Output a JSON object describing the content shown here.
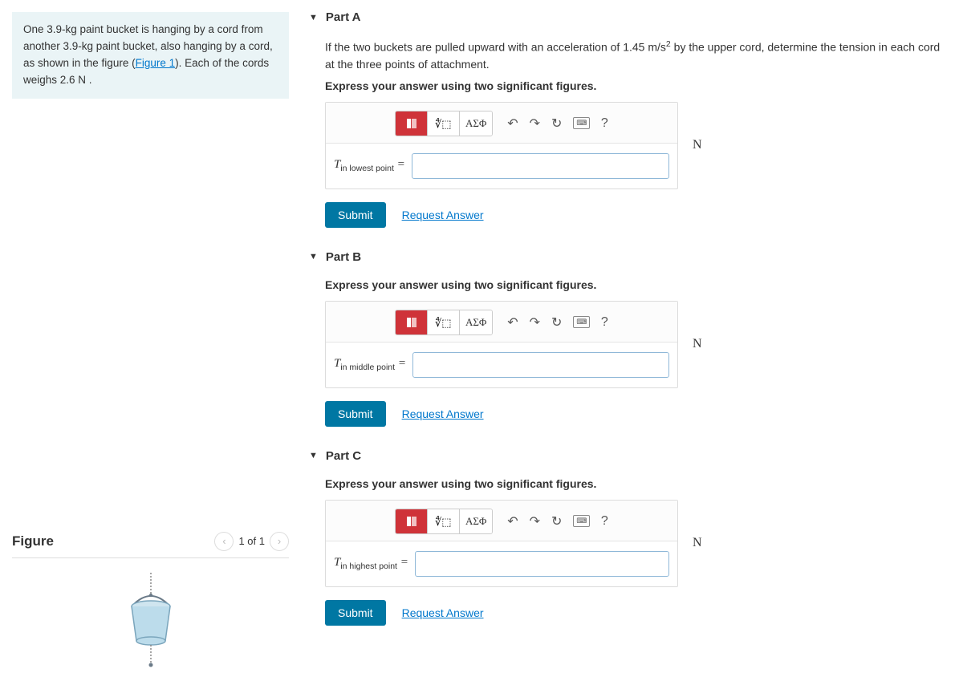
{
  "problem": {
    "text_before_link": "One 3.9-kg paint bucket is hanging by a cord from another 3.9-kg paint bucket, also hanging by a cord, as shown in the figure (",
    "link_text": "Figure 1",
    "text_after_link": "). Each of the cords weighs 2.6 N ."
  },
  "figure": {
    "title": "Figure",
    "counter": "1 of 1"
  },
  "parts": {
    "a": {
      "header": "Part A",
      "prompt_prefix": "If the two buckets are pulled upward with an acceleration of 1.45 ",
      "prompt_unit": "m/s",
      "prompt_suffix": " by the upper cord, determine the tension in each cord at the three points of attachment.",
      "sigfigs": "Express your answer using two significant figures.",
      "var_main": "T",
      "var_sub": "in lowest point",
      "equals": " = ",
      "unit": "N",
      "submit": "Submit",
      "request": "Request Answer"
    },
    "b": {
      "header": "Part B",
      "sigfigs": "Express your answer using two significant figures.",
      "var_main": "T",
      "var_sub": "in middle point",
      "equals": " = ",
      "unit": "N",
      "submit": "Submit",
      "request": "Request Answer"
    },
    "c": {
      "header": "Part C",
      "sigfigs": "Express your answer using two significant figures.",
      "var_main": "T",
      "var_sub": "in highest point",
      "equals": " = ",
      "unit": "N",
      "submit": "Submit",
      "request": "Request Answer"
    }
  },
  "toolbar": {
    "greek": "ΑΣΦ",
    "help": "?"
  }
}
